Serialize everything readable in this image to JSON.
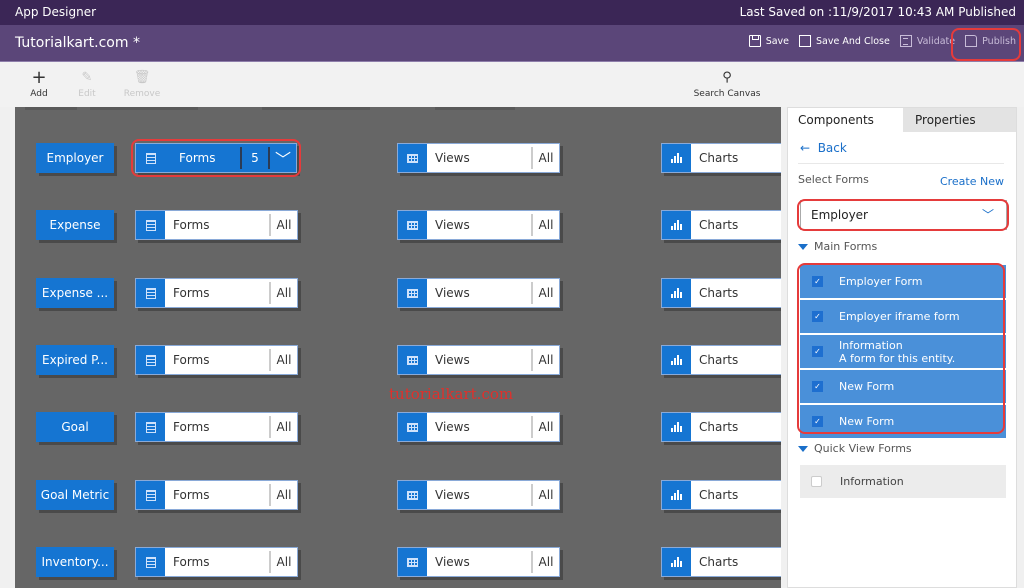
{
  "topbar": {
    "app_title": "App Designer",
    "last_saved": "Last Saved on :11/9/2017 10:43 AM Published"
  },
  "titlebar": {
    "app_name": "Tutorialkart.com *",
    "commands": [
      {
        "label": "Save",
        "icon": "save-icon",
        "enabled": true
      },
      {
        "label": "Save And Close",
        "icon": "save-close-icon",
        "enabled": true
      },
      {
        "label": "Validate",
        "icon": "validate-icon",
        "enabled": false
      },
      {
        "label": "Publish",
        "icon": "publish-icon",
        "enabled": false,
        "highlighted": true
      }
    ]
  },
  "toolbar": {
    "add_label": "Add",
    "edit_label": "Edit",
    "remove_label": "Remove",
    "search_label": "Search Canvas"
  },
  "canvas": {
    "watermark": "tutorialkart.com",
    "rows": [
      {
        "entity": "Employer",
        "forms": {
          "label": "Forms",
          "count": "5",
          "active": true
        },
        "views": {
          "label": "Views",
          "count": "All"
        },
        "charts": {
          "label": "Charts"
        }
      },
      {
        "entity": "Expense",
        "forms": {
          "label": "Forms",
          "count": "All"
        },
        "views": {
          "label": "Views",
          "count": "All"
        },
        "charts": {
          "label": "Charts"
        }
      },
      {
        "entity": "Expense ...",
        "forms": {
          "label": "Forms",
          "count": "All"
        },
        "views": {
          "label": "Views",
          "count": "All"
        },
        "charts": {
          "label": "Charts"
        }
      },
      {
        "entity": "Expired P...",
        "forms": {
          "label": "Forms",
          "count": "All"
        },
        "views": {
          "label": "Views",
          "count": "All"
        },
        "charts": {
          "label": "Charts"
        }
      },
      {
        "entity": "Goal",
        "forms": {
          "label": "Forms",
          "count": "All"
        },
        "views": {
          "label": "Views",
          "count": "All"
        },
        "charts": {
          "label": "Charts"
        }
      },
      {
        "entity": "Goal Metric",
        "forms": {
          "label": "Forms",
          "count": "All"
        },
        "views": {
          "label": "Views",
          "count": "All"
        },
        "charts": {
          "label": "Charts"
        }
      },
      {
        "entity": "Inventory...",
        "forms": {
          "label": "Forms",
          "count": "All"
        },
        "views": {
          "label": "Views",
          "count": "All"
        },
        "charts": {
          "label": "Charts"
        }
      }
    ]
  },
  "panel": {
    "tabs": [
      {
        "label": "Components",
        "active": true
      },
      {
        "label": "Properties",
        "active": false
      }
    ],
    "back_label": "Back",
    "select_label": "Select Forms",
    "create_new_label": "Create New",
    "selected_entity": "Employer",
    "main_forms_heading": "Main Forms",
    "main_forms": [
      {
        "title": "Employer Form",
        "subtitle": "",
        "checked": true
      },
      {
        "title": "Employer iframe form",
        "subtitle": "",
        "checked": true
      },
      {
        "title": "Information",
        "subtitle": "A form for this entity.",
        "checked": true
      },
      {
        "title": "New Form",
        "subtitle": "",
        "checked": true
      },
      {
        "title": "New Form",
        "subtitle": "",
        "checked": true
      }
    ],
    "quick_view_heading": "Quick View Forms",
    "quick_view_forms": [
      {
        "title": "Information",
        "checked": false
      }
    ]
  },
  "colors": {
    "topbar": "#3b2656",
    "titlebar": "#5b4679",
    "accent": "#1575d2",
    "canvas": "#666666",
    "highlight_ring": "#e53b3b"
  }
}
